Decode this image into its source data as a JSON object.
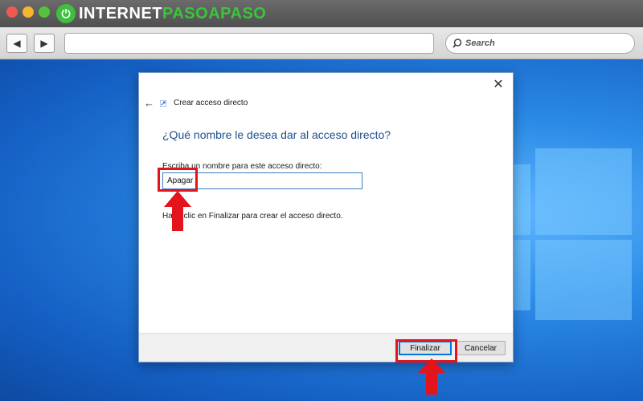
{
  "browser": {
    "logo_left": "INTERNET",
    "logo_right": "PASOAPASO",
    "logo_badge": "⏻",
    "search_placeholder": "Search",
    "back_glyph": "◀",
    "forward_glyph": "▶"
  },
  "dialog": {
    "title": "Crear acceso directo",
    "heading": "¿Qué nombre le desea dar al acceso directo?",
    "field_label": "Escriba un nombre para este acceso directo:",
    "name_value": "Apagar",
    "hint": "Haga clic en Finalizar para crear el acceso directo.",
    "finish_label": "Finalizar",
    "cancel_label": "Cancelar",
    "close_glyph": "✕",
    "back_glyph": "←"
  },
  "icons": {
    "back_nav": "chevron-left-icon",
    "forward_nav": "chevron-right-icon",
    "search": "search-icon",
    "close": "close-icon",
    "back": "arrow-left-icon"
  },
  "colors": {
    "accent": "#0078d7",
    "heading": "#1f4e8c",
    "annotation": "#e3141b",
    "logo_green": "#39c63a"
  }
}
